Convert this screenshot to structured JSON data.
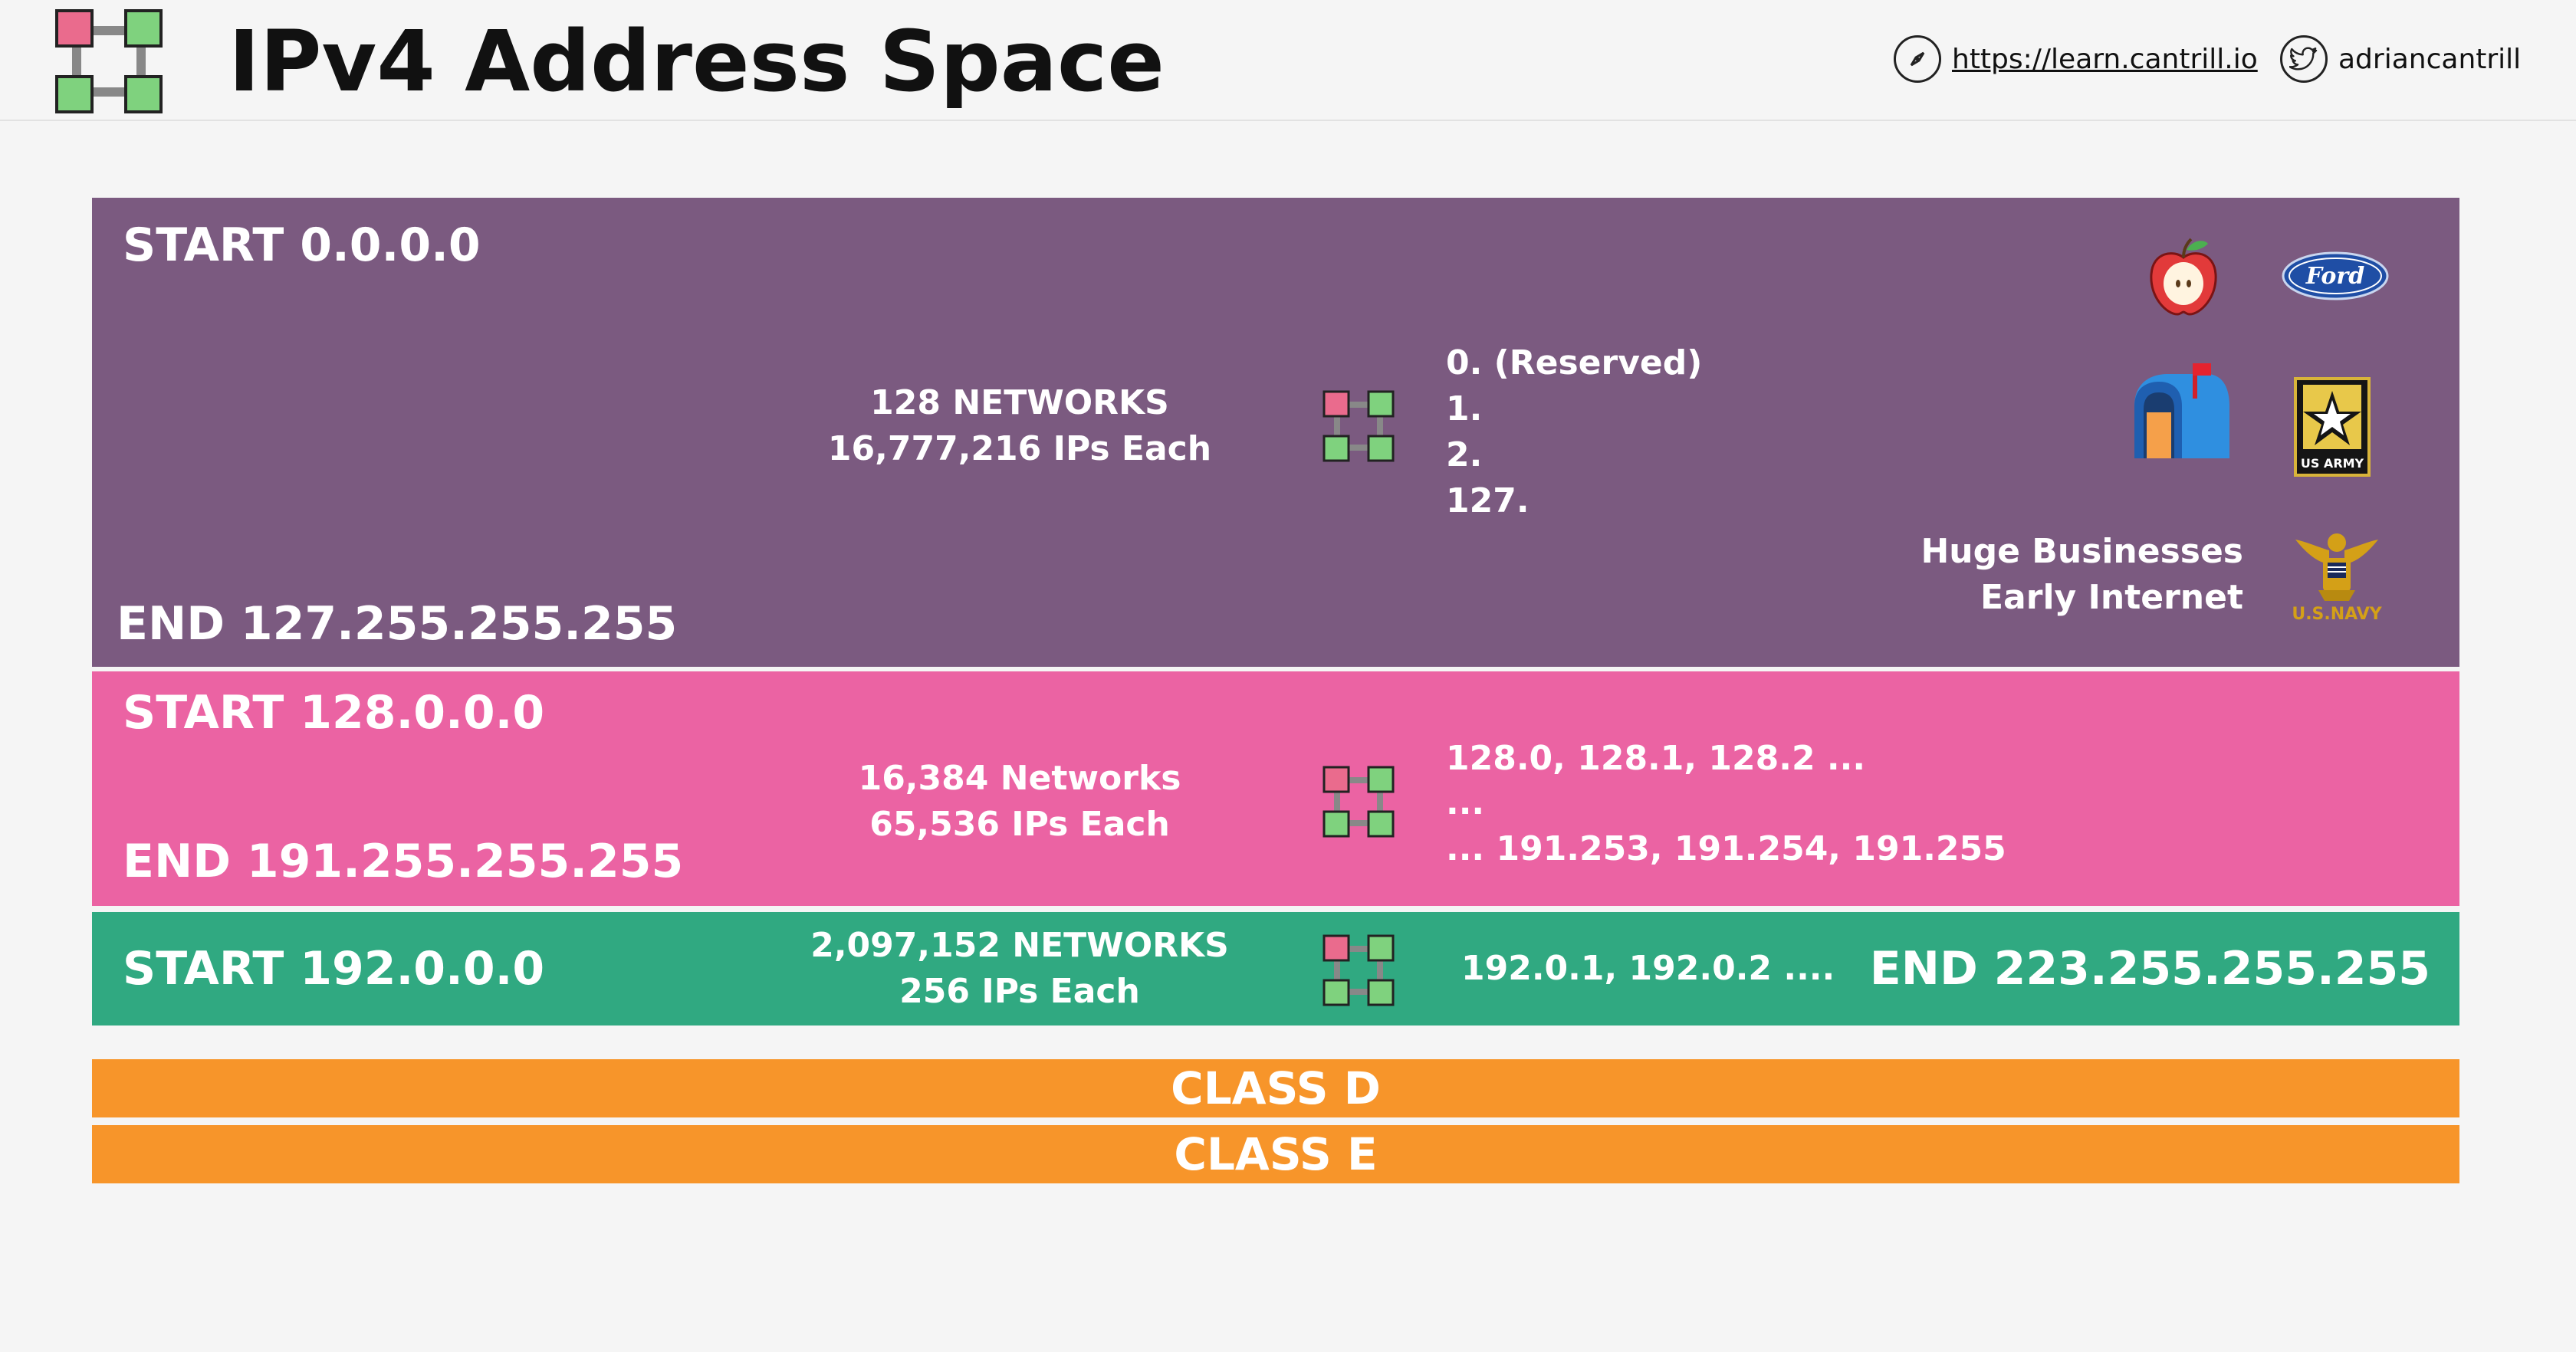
{
  "header": {
    "title": "IPv4 Address Space",
    "site_link": "https://learn.cantrill.io",
    "twitter_handle": "adriancantrill",
    "icons": [
      "network-logo-icon",
      "compass-icon",
      "twitter-icon"
    ]
  },
  "class_a": {
    "start": "START 0.0.0.0",
    "end": "END 127.255.255.255",
    "networks": "128 NETWORKS",
    "ips_each": "16,777,216 IPs Each",
    "list": [
      "0. (Reserved)",
      "1.",
      "2.",
      "127."
    ],
    "note_line1": "Huge Businesses",
    "note_line2": "Early Internet",
    "logo_ford_text": "Ford",
    "logo_army_text": "US ARMY",
    "logo_navy_text": "U.S.NAVY",
    "logos": [
      "apple-logo-icon",
      "ford-logo-icon",
      "mailbox-icon",
      "us-army-logo-icon",
      "us-navy-logo-icon"
    ],
    "color": "#7b5a80"
  },
  "class_b": {
    "start": "START 128.0.0.0",
    "end": "END 191.255.255.255",
    "networks": "16,384 Networks",
    "ips_each": "65,536 IPs Each",
    "list": [
      "128.0, 128.1, 128.2 ...",
      "...",
      "... 191.253, 191.254, 191.255"
    ],
    "color": "#eb63a3"
  },
  "class_c": {
    "start": "START 192.0.0.0",
    "end": "END 223.255.255.255",
    "networks": "2,097,152 NETWORKS",
    "ips_each": "256 IPs Each",
    "list": "192.0.1, 192.0.2 ....",
    "color": "#30a981"
  },
  "class_d": {
    "label": "CLASS D",
    "color": "#f7952a"
  },
  "class_e": {
    "label": "CLASS E",
    "color": "#f7952a"
  }
}
